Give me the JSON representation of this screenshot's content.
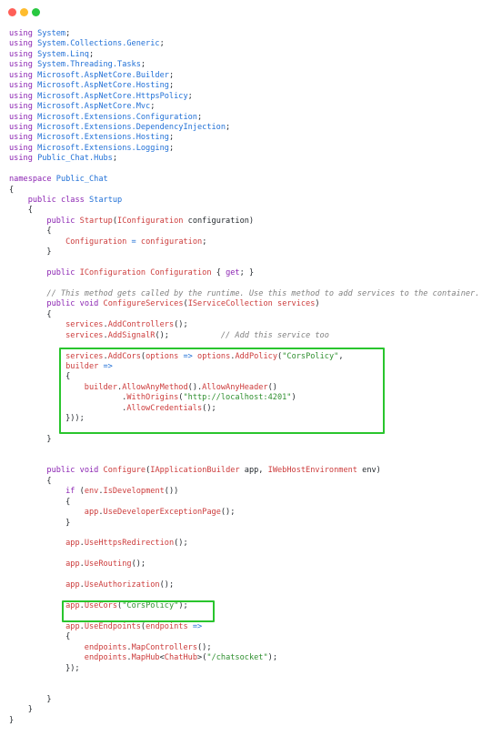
{
  "window": {
    "traffic_lights": [
      {
        "name": "close",
        "color": "#ff5f57"
      },
      {
        "name": "minimize",
        "color": "#febc2e"
      },
      {
        "name": "zoom",
        "color": "#28c840"
      }
    ]
  },
  "highlight_color": "#29c52d",
  "code_lines": [
    [
      [
        "kw",
        "using"
      ],
      [
        "t",
        " "
      ],
      [
        "ty",
        "System"
      ],
      [
        "t",
        ";"
      ]
    ],
    [
      [
        "kw",
        "using"
      ],
      [
        "t",
        " "
      ],
      [
        "ty",
        "System.Collections.Generic"
      ],
      [
        "t",
        ";"
      ]
    ],
    [
      [
        "kw",
        "using"
      ],
      [
        "t",
        " "
      ],
      [
        "ty",
        "System.Linq"
      ],
      [
        "t",
        ";"
      ]
    ],
    [
      [
        "kw",
        "using"
      ],
      [
        "t",
        " "
      ],
      [
        "ty",
        "System.Threading.Tasks"
      ],
      [
        "t",
        ";"
      ]
    ],
    [
      [
        "kw",
        "using"
      ],
      [
        "t",
        " "
      ],
      [
        "ty",
        "Microsoft.AspNetCore.Builder"
      ],
      [
        "t",
        ";"
      ]
    ],
    [
      [
        "kw",
        "using"
      ],
      [
        "t",
        " "
      ],
      [
        "ty",
        "Microsoft.AspNetCore.Hosting"
      ],
      [
        "t",
        ";"
      ]
    ],
    [
      [
        "kw",
        "using"
      ],
      [
        "t",
        " "
      ],
      [
        "ty",
        "Microsoft.AspNetCore.HttpsPolicy"
      ],
      [
        "t",
        ";"
      ]
    ],
    [
      [
        "kw",
        "using"
      ],
      [
        "t",
        " "
      ],
      [
        "ty",
        "Microsoft.AspNetCore.Mvc"
      ],
      [
        "t",
        ";"
      ]
    ],
    [
      [
        "kw",
        "using"
      ],
      [
        "t",
        " "
      ],
      [
        "ty",
        "Microsoft.Extensions.Configuration"
      ],
      [
        "t",
        ";"
      ]
    ],
    [
      [
        "kw",
        "using"
      ],
      [
        "t",
        " "
      ],
      [
        "ty",
        "Microsoft.Extensions.DependencyInjection"
      ],
      [
        "t",
        ";"
      ]
    ],
    [
      [
        "kw",
        "using"
      ],
      [
        "t",
        " "
      ],
      [
        "ty",
        "Microsoft.Extensions.Hosting"
      ],
      [
        "t",
        ";"
      ]
    ],
    [
      [
        "kw",
        "using"
      ],
      [
        "t",
        " "
      ],
      [
        "ty",
        "Microsoft.Extensions.Logging"
      ],
      [
        "t",
        ";"
      ]
    ],
    [
      [
        "kw",
        "using"
      ],
      [
        "t",
        " "
      ],
      [
        "ty",
        "Public_Chat.Hubs"
      ],
      [
        "t",
        ";"
      ]
    ],
    [],
    [
      [
        "kw",
        "namespace"
      ],
      [
        "t",
        " "
      ],
      [
        "ty",
        "Public_Chat"
      ]
    ],
    [
      [
        "t",
        "{"
      ]
    ],
    [
      [
        "t",
        "    "
      ],
      [
        "kw",
        "public"
      ],
      [
        "t",
        " "
      ],
      [
        "kw",
        "class"
      ],
      [
        "t",
        " "
      ],
      [
        "ty",
        "Startup"
      ]
    ],
    [
      [
        "t",
        "    {"
      ]
    ],
    [
      [
        "t",
        "        "
      ],
      [
        "kw",
        "public"
      ],
      [
        "t",
        " "
      ],
      [
        "fn",
        "Startup"
      ],
      [
        "t",
        "("
      ],
      [
        "fn",
        "IConfiguration"
      ],
      [
        "t",
        " configuration)"
      ]
    ],
    [
      [
        "t",
        "        {"
      ]
    ],
    [
      [
        "t",
        "            "
      ],
      [
        "fn",
        "Configuration"
      ],
      [
        "t",
        " "
      ],
      [
        "op",
        "="
      ],
      [
        "t",
        " "
      ],
      [
        "fn",
        "configuration"
      ],
      [
        "t",
        ";"
      ]
    ],
    [
      [
        "t",
        "        }"
      ]
    ],
    [],
    [
      [
        "t",
        "        "
      ],
      [
        "kw",
        "public"
      ],
      [
        "t",
        " "
      ],
      [
        "fn",
        "IConfiguration"
      ],
      [
        "t",
        " "
      ],
      [
        "fn",
        "Configuration"
      ],
      [
        "t",
        " { "
      ],
      [
        "kw",
        "get"
      ],
      [
        "t",
        "; }"
      ]
    ],
    [],
    [
      [
        "cm",
        "        // This method gets called by the runtime. Use this method to add services to the container."
      ]
    ],
    [
      [
        "t",
        "        "
      ],
      [
        "kw",
        "public"
      ],
      [
        "t",
        " "
      ],
      [
        "kw",
        "void"
      ],
      [
        "t",
        " "
      ],
      [
        "fn",
        "ConfigureServices"
      ],
      [
        "t",
        "("
      ],
      [
        "fn",
        "IServiceCollection"
      ],
      [
        "t",
        " "
      ],
      [
        "fn",
        "services"
      ],
      [
        "t",
        ")"
      ]
    ],
    [
      [
        "t",
        "        {"
      ]
    ],
    [
      [
        "t",
        "            "
      ],
      [
        "fn",
        "services"
      ],
      [
        "t",
        "."
      ],
      [
        "fn",
        "AddControllers"
      ],
      [
        "t",
        "();"
      ]
    ],
    [
      [
        "t",
        "            "
      ],
      [
        "fn",
        "services"
      ],
      [
        "t",
        "."
      ],
      [
        "fn",
        "AddSignalR"
      ],
      [
        "t",
        "();           "
      ],
      [
        "cm",
        "// Add this service too"
      ]
    ],
    [],
    [
      [
        "t",
        "            "
      ],
      [
        "fn",
        "services"
      ],
      [
        "t",
        "."
      ],
      [
        "fn",
        "AddCors"
      ],
      [
        "t",
        "("
      ],
      [
        "fn",
        "options"
      ],
      [
        "t",
        " "
      ],
      [
        "op",
        "=>"
      ],
      [
        "t",
        " "
      ],
      [
        "fn",
        "options"
      ],
      [
        "t",
        "."
      ],
      [
        "fn",
        "AddPolicy"
      ],
      [
        "t",
        "("
      ],
      [
        "str",
        "\"CorsPolicy\""
      ],
      [
        "t",
        ","
      ]
    ],
    [
      [
        "t",
        "            "
      ],
      [
        "fn",
        "builder"
      ],
      [
        "t",
        " "
      ],
      [
        "op",
        "=>"
      ]
    ],
    [
      [
        "t",
        "            {"
      ]
    ],
    [
      [
        "t",
        "                "
      ],
      [
        "fn",
        "builder"
      ],
      [
        "t",
        "."
      ],
      [
        "fn",
        "AllowAnyMethod"
      ],
      [
        "t",
        "()."
      ],
      [
        "fn",
        "AllowAnyHeader"
      ],
      [
        "t",
        "()"
      ]
    ],
    [
      [
        "t",
        "                        ."
      ],
      [
        "fn",
        "WithOrigins"
      ],
      [
        "t",
        "("
      ],
      [
        "str",
        "\"http://localhost:4201\""
      ],
      [
        "t",
        ")"
      ]
    ],
    [
      [
        "t",
        "                        ."
      ],
      [
        "fn",
        "AllowCredentials"
      ],
      [
        "t",
        "();"
      ]
    ],
    [
      [
        "t",
        "            }));"
      ]
    ],
    [],
    [
      [
        "t",
        "        }"
      ]
    ],
    [],
    [],
    [
      [
        "t",
        "        "
      ],
      [
        "kw",
        "public"
      ],
      [
        "t",
        " "
      ],
      [
        "kw",
        "void"
      ],
      [
        "t",
        " "
      ],
      [
        "fn",
        "Configure"
      ],
      [
        "t",
        "("
      ],
      [
        "fn",
        "IApplicationBuilder"
      ],
      [
        "t",
        " app, "
      ],
      [
        "fn",
        "IWebHostEnvironment"
      ],
      [
        "t",
        " env)"
      ]
    ],
    [
      [
        "t",
        "        {"
      ]
    ],
    [
      [
        "t",
        "            "
      ],
      [
        "kw",
        "if"
      ],
      [
        "t",
        " ("
      ],
      [
        "fn",
        "env"
      ],
      [
        "t",
        "."
      ],
      [
        "fn",
        "IsDevelopment"
      ],
      [
        "t",
        "())"
      ]
    ],
    [
      [
        "t",
        "            {"
      ]
    ],
    [
      [
        "t",
        "                "
      ],
      [
        "fn",
        "app"
      ],
      [
        "t",
        "."
      ],
      [
        "fn",
        "UseDeveloperExceptionPage"
      ],
      [
        "t",
        "();"
      ]
    ],
    [
      [
        "t",
        "            }"
      ]
    ],
    [],
    [
      [
        "t",
        "            "
      ],
      [
        "fn",
        "app"
      ],
      [
        "t",
        "."
      ],
      [
        "fn",
        "UseHttpsRedirection"
      ],
      [
        "t",
        "();"
      ]
    ],
    [],
    [
      [
        "t",
        "            "
      ],
      [
        "fn",
        "app"
      ],
      [
        "t",
        "."
      ],
      [
        "fn",
        "UseRouting"
      ],
      [
        "t",
        "();"
      ]
    ],
    [],
    [
      [
        "t",
        "            "
      ],
      [
        "fn",
        "app"
      ],
      [
        "t",
        "."
      ],
      [
        "fn",
        "UseAuthorization"
      ],
      [
        "t",
        "();"
      ]
    ],
    [],
    [
      [
        "t",
        "            "
      ],
      [
        "fn",
        "app"
      ],
      [
        "t",
        "."
      ],
      [
        "fn",
        "UseCors"
      ],
      [
        "t",
        "("
      ],
      [
        "str",
        "\"CorsPolicy\""
      ],
      [
        "t",
        ");"
      ]
    ],
    [],
    [
      [
        "t",
        "            "
      ],
      [
        "fn",
        "app"
      ],
      [
        "t",
        "."
      ],
      [
        "fn",
        "UseEndpoints"
      ],
      [
        "t",
        "("
      ],
      [
        "fn",
        "endpoints"
      ],
      [
        "t",
        " "
      ],
      [
        "op",
        "=>"
      ]
    ],
    [
      [
        "t",
        "            {"
      ]
    ],
    [
      [
        "t",
        "                "
      ],
      [
        "fn",
        "endpoints"
      ],
      [
        "t",
        "."
      ],
      [
        "fn",
        "MapControllers"
      ],
      [
        "t",
        "();"
      ]
    ],
    [
      [
        "t",
        "                "
      ],
      [
        "fn",
        "endpoints"
      ],
      [
        "t",
        "."
      ],
      [
        "fn",
        "MapHub"
      ],
      [
        "t",
        "<"
      ],
      [
        "fn",
        "ChatHub"
      ],
      [
        "t",
        ">("
      ],
      [
        "str",
        "\"/chatsocket\""
      ],
      [
        "t",
        ");"
      ]
    ],
    [
      [
        "t",
        "            });"
      ]
    ],
    [],
    [],
    [
      [
        "t",
        "        }"
      ]
    ],
    [
      [
        "t",
        "    }"
      ]
    ],
    [
      [
        "t",
        "}"
      ]
    ]
  ]
}
